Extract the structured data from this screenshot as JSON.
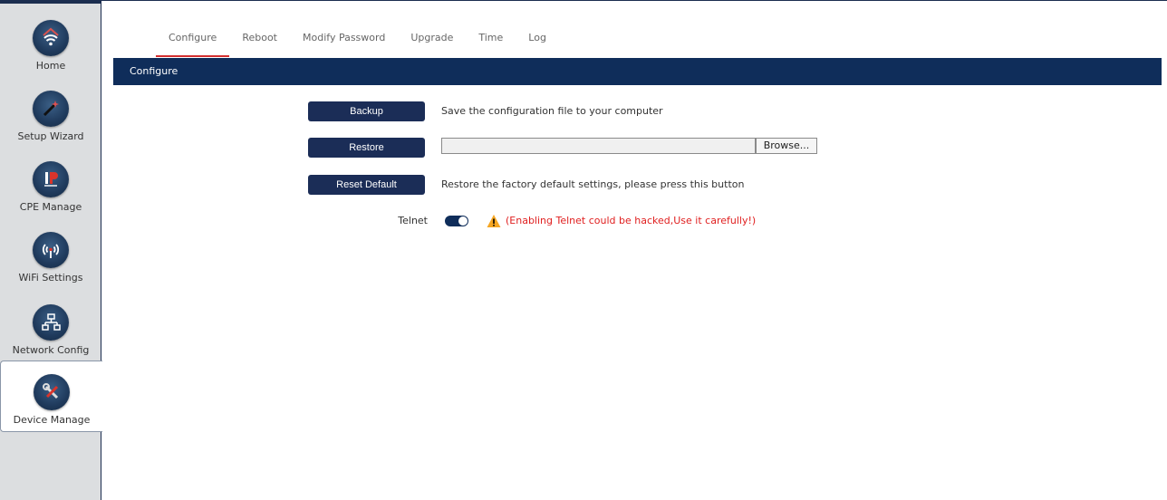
{
  "sidebar": {
    "items": [
      {
        "label": "Home",
        "icon": "wifi-home-icon"
      },
      {
        "label": "Setup Wizard",
        "icon": "wizard-wand-icon"
      },
      {
        "label": "CPE Manage",
        "icon": "ip-icon"
      },
      {
        "label": "WiFi Settings",
        "icon": "wifi-antenna-icon"
      },
      {
        "label": "Network Config",
        "icon": "network-icon"
      },
      {
        "label": "Device Manage",
        "icon": "tools-icon",
        "active": true
      }
    ]
  },
  "tabs": [
    {
      "label": "Configure",
      "active": true
    },
    {
      "label": "Reboot"
    },
    {
      "label": "Modify Password"
    },
    {
      "label": "Upgrade"
    },
    {
      "label": "Time"
    },
    {
      "label": "Log"
    }
  ],
  "section": {
    "title": "Configure"
  },
  "configure": {
    "backup_label": "Backup",
    "backup_desc": "Save the configuration file to your computer",
    "restore_label": "Restore",
    "restore_file_value": "",
    "browse_label": "Browse...",
    "reset_label": "Reset Default",
    "reset_desc": "Restore the factory default settings, please press this button",
    "telnet_label": "Telnet",
    "telnet_enabled": true,
    "telnet_warning": "(Enabling Telnet could be hacked,Use it carefully!)"
  },
  "colors": {
    "primary": "#0f2d5a",
    "button": "#1b2d57",
    "warning_text": "#e02020",
    "tab_active_underline": "#d32f2f"
  }
}
